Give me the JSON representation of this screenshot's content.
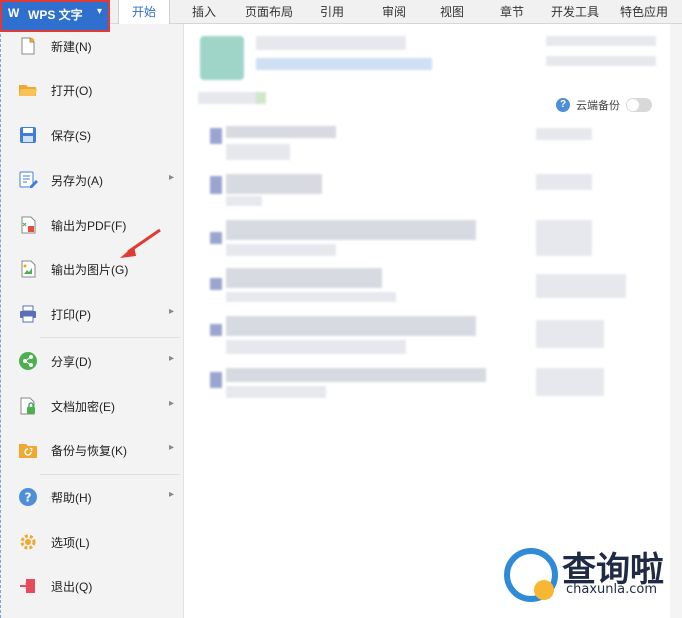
{
  "app": {
    "logo": "W",
    "title": "WPS 文字",
    "caret": "▾"
  },
  "tabs": [
    {
      "label": "开始",
      "active": true
    },
    {
      "label": "插入"
    },
    {
      "label": "页面布局"
    },
    {
      "label": "引用"
    },
    {
      "label": "审阅"
    },
    {
      "label": "视图"
    },
    {
      "label": "章节"
    },
    {
      "label": "开发工具"
    },
    {
      "label": "特色应用"
    }
  ],
  "menu": {
    "items": [
      {
        "label": "新建(N)",
        "icon": "new-doc-icon",
        "has_submenu": false
      },
      {
        "label": "打开(O)",
        "icon": "folder-open-icon",
        "has_submenu": false
      },
      {
        "label": "保存(S)",
        "icon": "save-icon",
        "has_submenu": false
      },
      {
        "label": "另存为(A)",
        "icon": "save-as-icon",
        "has_submenu": true
      },
      {
        "label": "输出为PDF(F)",
        "icon": "pdf-export-icon",
        "has_submenu": false
      },
      {
        "label": "输出为图片(G)",
        "icon": "image-export-icon",
        "has_submenu": false
      },
      {
        "label": "打印(P)",
        "icon": "printer-icon",
        "has_submenu": true
      },
      {
        "label": "分享(D)",
        "icon": "share-icon",
        "has_submenu": true
      },
      {
        "label": "文档加密(E)",
        "icon": "lock-doc-icon",
        "has_submenu": true
      },
      {
        "label": "备份与恢复(K)",
        "icon": "backup-icon",
        "has_submenu": true
      },
      {
        "label": "帮助(H)",
        "icon": "help-icon",
        "has_submenu": true
      },
      {
        "label": "选项(L)",
        "icon": "gear-icon",
        "has_submenu": false
      },
      {
        "label": "退出(Q)",
        "icon": "exit-icon",
        "has_submenu": false
      }
    ],
    "chevron": "▸"
  },
  "cloud_backup": {
    "help_glyph": "?",
    "label": "云端备份"
  },
  "watermark": {
    "text": "查询啦",
    "url": "chaxunla.com"
  },
  "colors": {
    "accent": "#2f6fce",
    "highlight_border": "#e03a34",
    "arrow": "#e03a34"
  }
}
